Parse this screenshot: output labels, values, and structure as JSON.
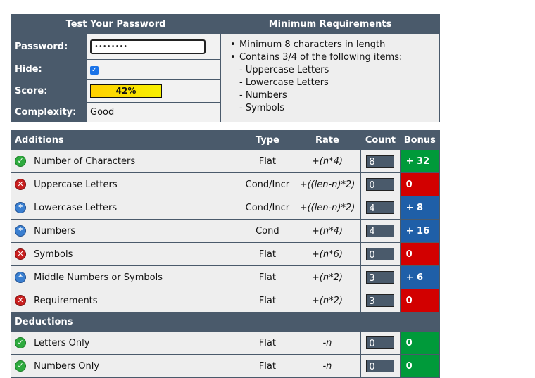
{
  "top": {
    "title": "Test Your Password",
    "req_title": "Minimum Requirements",
    "password_label": "Password:",
    "password_value": "••••••••",
    "hide_label": "Hide:",
    "score_label": "Score:",
    "score_value": "42%",
    "score_fraction": 0.42,
    "complexity_label": "Complexity:",
    "complexity_value": "Good",
    "requirements": [
      "Minimum 8 characters in length",
      "Contains 3/4 of the following items:",
      "- Uppercase Letters",
      "- Lowercase Letters",
      "- Numbers",
      "- Symbols"
    ]
  },
  "headers": {
    "additions": "Additions",
    "type": "Type",
    "rate": "Rate",
    "count": "Count",
    "bonus": "Bonus",
    "deductions": "Deductions"
  },
  "additions": [
    {
      "icon": "check-icon",
      "name": "Number of Characters",
      "type": "Flat",
      "rate": "+(n*4)",
      "count": "8",
      "bonus": "+ 32",
      "status": "green"
    },
    {
      "icon": "cross-icon",
      "name": "Uppercase Letters",
      "type": "Cond/Incr",
      "rate": "+((len-n)*2)",
      "count": "0",
      "bonus": "0",
      "status": "red"
    },
    {
      "icon": "info-icon",
      "name": "Lowercase Letters",
      "type": "Cond/Incr",
      "rate": "+((len-n)*2)",
      "count": "4",
      "bonus": "+ 8",
      "status": "blue"
    },
    {
      "icon": "info-icon",
      "name": "Numbers",
      "type": "Cond",
      "rate": "+(n*4)",
      "count": "4",
      "bonus": "+ 16",
      "status": "blue"
    },
    {
      "icon": "cross-icon",
      "name": "Symbols",
      "type": "Flat",
      "rate": "+(n*6)",
      "count": "0",
      "bonus": "0",
      "status": "red"
    },
    {
      "icon": "info-icon",
      "name": "Middle Numbers or Symbols",
      "type": "Flat",
      "rate": "+(n*2)",
      "count": "3",
      "bonus": "+ 6",
      "status": "blue"
    },
    {
      "icon": "cross-icon",
      "name": "Requirements",
      "type": "Flat",
      "rate": "+(n*2)",
      "count": "3",
      "bonus": "0",
      "status": "red"
    }
  ],
  "deductions": [
    {
      "icon": "check-icon",
      "name": "Letters Only",
      "type": "Flat",
      "rate": "-n",
      "count": "0",
      "bonus": "0",
      "status": "green"
    },
    {
      "icon": "check-icon",
      "name": "Numbers Only",
      "type": "Flat",
      "rate": "-n",
      "count": "0",
      "bonus": "0",
      "status": "green"
    }
  ],
  "colors": {
    "header": "#4a5a6b",
    "green": "#009a3a",
    "red": "#d20000",
    "blue": "#1f5fa8",
    "score": "#ffd000"
  }
}
